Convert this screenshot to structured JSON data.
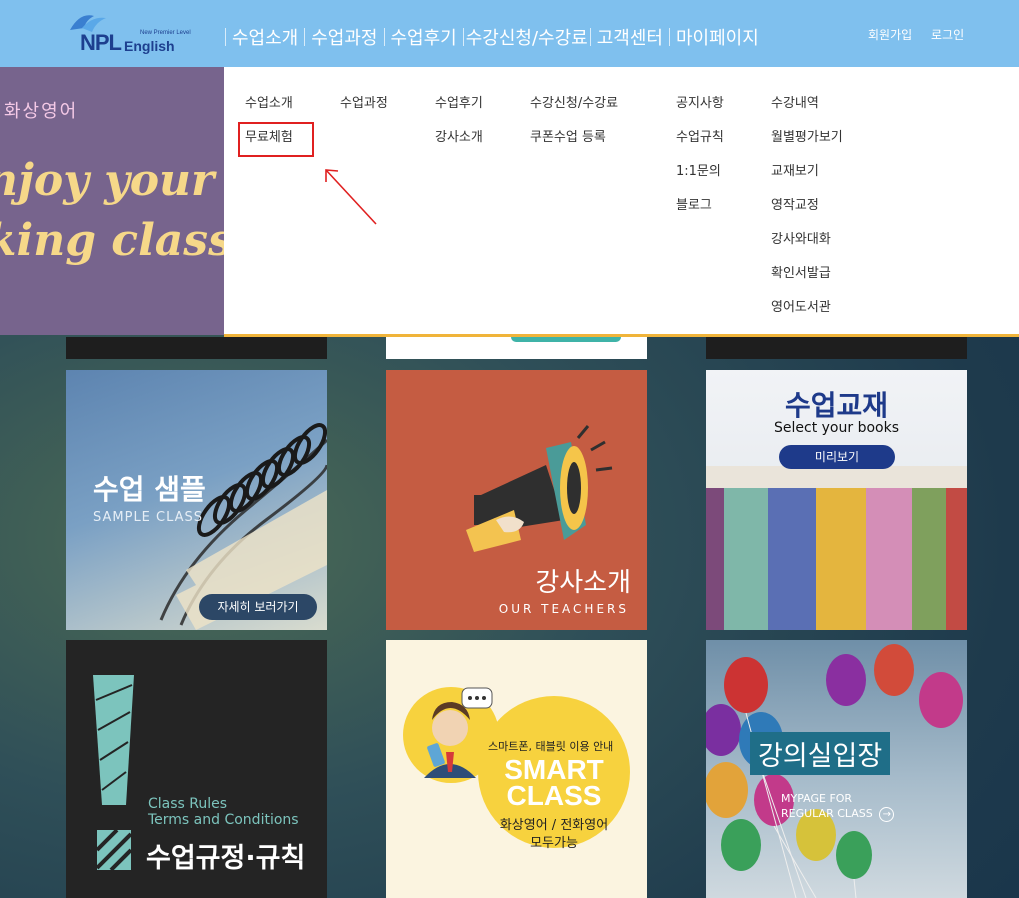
{
  "header": {
    "logo": {
      "brand": "NPL",
      "brand_sub": "English",
      "tagline": "New Premier Level"
    },
    "nav": [
      {
        "label": "수업소개"
      },
      {
        "label": "수업과정"
      },
      {
        "label": "수업후기"
      },
      {
        "label": "수강신청/수강료"
      },
      {
        "label": "고객센터"
      },
      {
        "label": "마이페이지"
      }
    ],
    "signup_label": "회원가입",
    "login_label": "로그인"
  },
  "promo": {
    "small_text": "화상영어",
    "line1": "njoy your",
    "line2": "king class"
  },
  "mega_menu": {
    "columns": [
      {
        "items": [
          "수업소개",
          "무료체험"
        ]
      },
      {
        "items": [
          "수업과정"
        ]
      },
      {
        "items": [
          "수업후기",
          "강사소개"
        ]
      },
      {
        "items": [
          "수강신청/수강료",
          "쿠폰수업 등록"
        ]
      },
      {
        "items": [
          "공지사항",
          "수업규칙",
          "1:1문의",
          "블로그"
        ]
      },
      {
        "items": [
          "수강내역",
          "월별평가보기",
          "교재보기",
          "영작교정",
          "강사와대화",
          "확인서발급",
          "영어도서관"
        ]
      }
    ]
  },
  "tiles": {
    "sample": {
      "title": "수업 샘플",
      "subtitle": "SAMPLE CLASS",
      "button": "자세히 보러가기"
    },
    "teachers": {
      "title": "강사소개",
      "subtitle": "OUR TEACHERS"
    },
    "books": {
      "title": "수업교재",
      "subtitle": "Select your books",
      "button": "미리보기"
    },
    "rules": {
      "en_line1": "Class Rules",
      "en_line2": "Terms and Conditions",
      "title": "수업규정·규칙"
    },
    "smart": {
      "notice": "스마트폰, 태블릿 이용 안내",
      "line1": "SMART",
      "line2": "CLASS",
      "desc1": "화상영어 / 전화영어",
      "desc2": "모두가능"
    },
    "classroom": {
      "title": "강의실입장",
      "sub1": "MYPAGE FOR",
      "sub2": "REGULAR CLASS"
    }
  },
  "colors": {
    "header_bg": "#7fc0ee",
    "menu_accent": "#f0b43a",
    "highlight_box": "#e02020",
    "promo_bg": "#77648d"
  }
}
